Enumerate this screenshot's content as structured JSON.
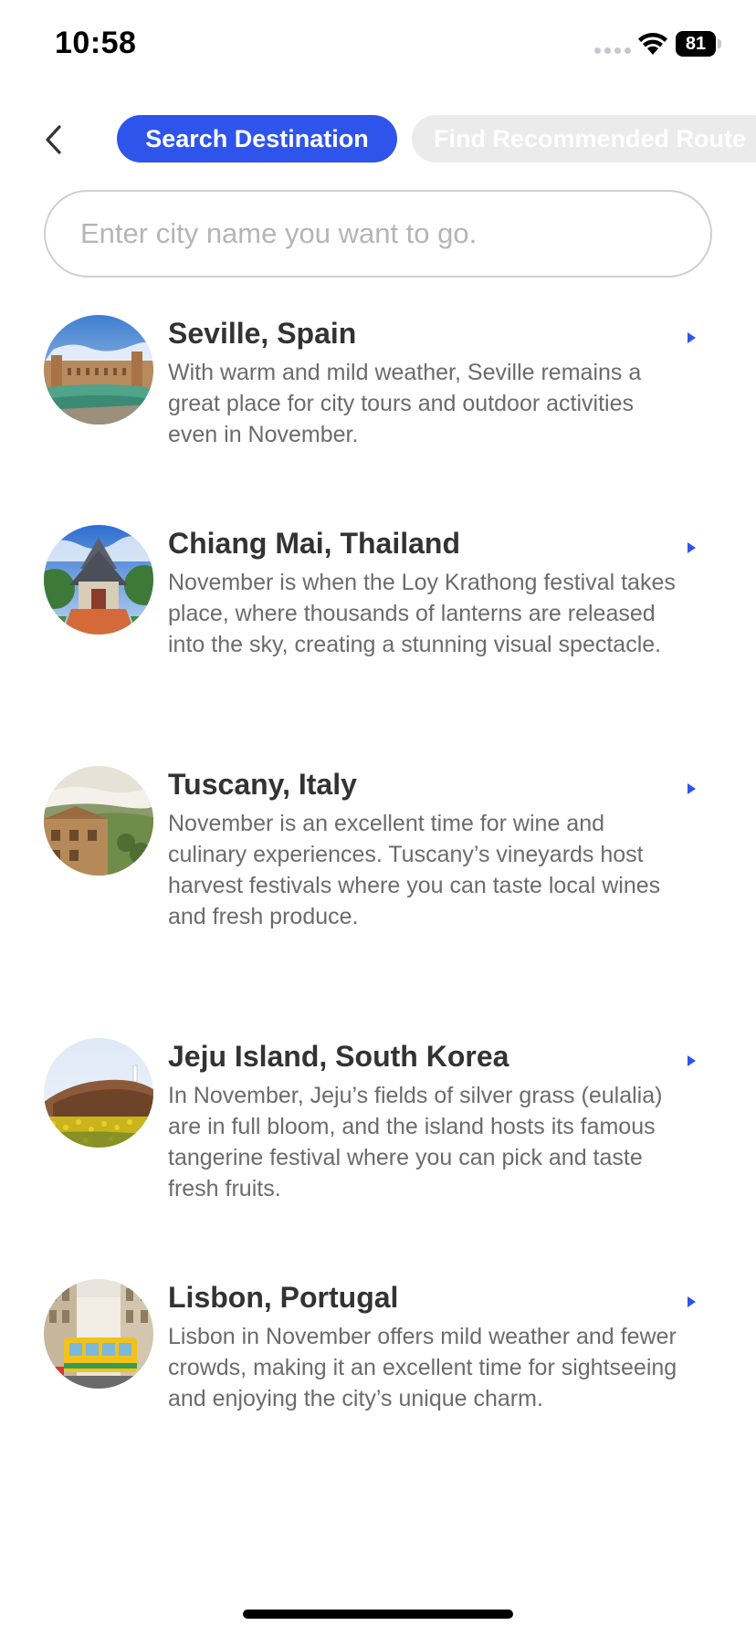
{
  "status_bar": {
    "time": "10:58",
    "battery": "81"
  },
  "header": {
    "back_icon": "chevron-left-icon",
    "tabs": [
      {
        "label": "Search Destination",
        "active": true
      },
      {
        "label": "Find Recommended Route",
        "active": false
      }
    ]
  },
  "search": {
    "placeholder": "Enter city name you want to go.",
    "value": ""
  },
  "destinations": [
    {
      "title": "Seville, Spain",
      "description": "With warm and mild weather, Seville remains a great place for city tours and outdoor activities even in November."
    },
    {
      "title": "Chiang Mai, Thailand",
      "description": "November is when the Loy Krathong festival takes place, where thousands of lanterns are released into the sky, creating a stunning visual spectacle."
    },
    {
      "title": "Tuscany, Italy",
      "description": "November is an excellent time for wine and culinary experiences. Tuscany’s vineyards host harvest festivals where you can taste local wines and fresh produce."
    },
    {
      "title": "Jeju Island, South Korea",
      "description": "In November, Jeju’s fields of silver grass (eulalia) are in full bloom, and the island hosts its famous tangerine festival where you can pick and taste fresh fruits."
    },
    {
      "title": "Lisbon, Portugal",
      "description": "Lisbon in November offers mild weather and fewer crowds, making it an excellent time for sightseeing and enjoying the city’s unique charm."
    }
  ],
  "colors": {
    "accent": "#2f54eb",
    "tab_inactive_bg": "#ebebeb",
    "title_text": "#333333",
    "body_text": "#6b6b6b"
  }
}
